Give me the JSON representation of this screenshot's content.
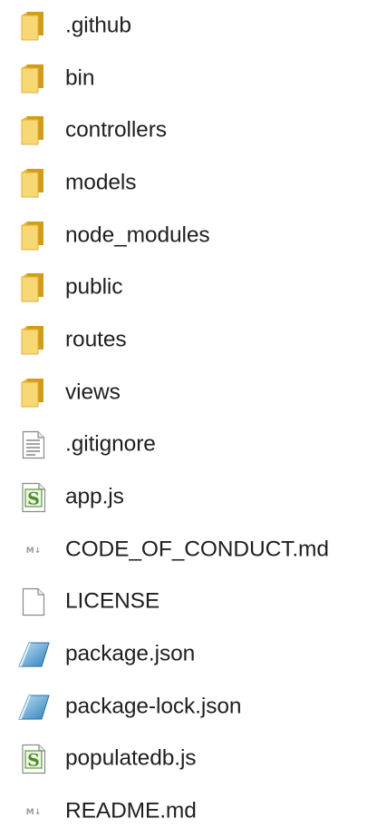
{
  "file_list": {
    "items": [
      {
        "name": ".github",
        "icon": "folder-icon"
      },
      {
        "name": "bin",
        "icon": "folder-icon"
      },
      {
        "name": "controllers",
        "icon": "folder-icon"
      },
      {
        "name": "models",
        "icon": "folder-icon"
      },
      {
        "name": "node_modules",
        "icon": "folder-icon"
      },
      {
        "name": "public",
        "icon": "folder-icon"
      },
      {
        "name": "routes",
        "icon": "folder-icon"
      },
      {
        "name": "views",
        "icon": "folder-icon"
      },
      {
        "name": ".gitignore",
        "icon": "text-file-icon"
      },
      {
        "name": "app.js",
        "icon": "script-file-icon"
      },
      {
        "name": "CODE_OF_CONDUCT.md",
        "icon": "markdown-file-icon"
      },
      {
        "name": "LICENSE",
        "icon": "blank-file-icon"
      },
      {
        "name": "package.json",
        "icon": "json-file-icon"
      },
      {
        "name": "package-lock.json",
        "icon": "json-file-icon"
      },
      {
        "name": "populatedb.js",
        "icon": "script-file-icon"
      },
      {
        "name": "README.md",
        "icon": "markdown-file-icon"
      }
    ]
  },
  "colors": {
    "folder_front": "#f8d775",
    "folder_back": "#e0a818",
    "script_green": "#5a9a3a",
    "json_blue": "#3f8fc6"
  }
}
